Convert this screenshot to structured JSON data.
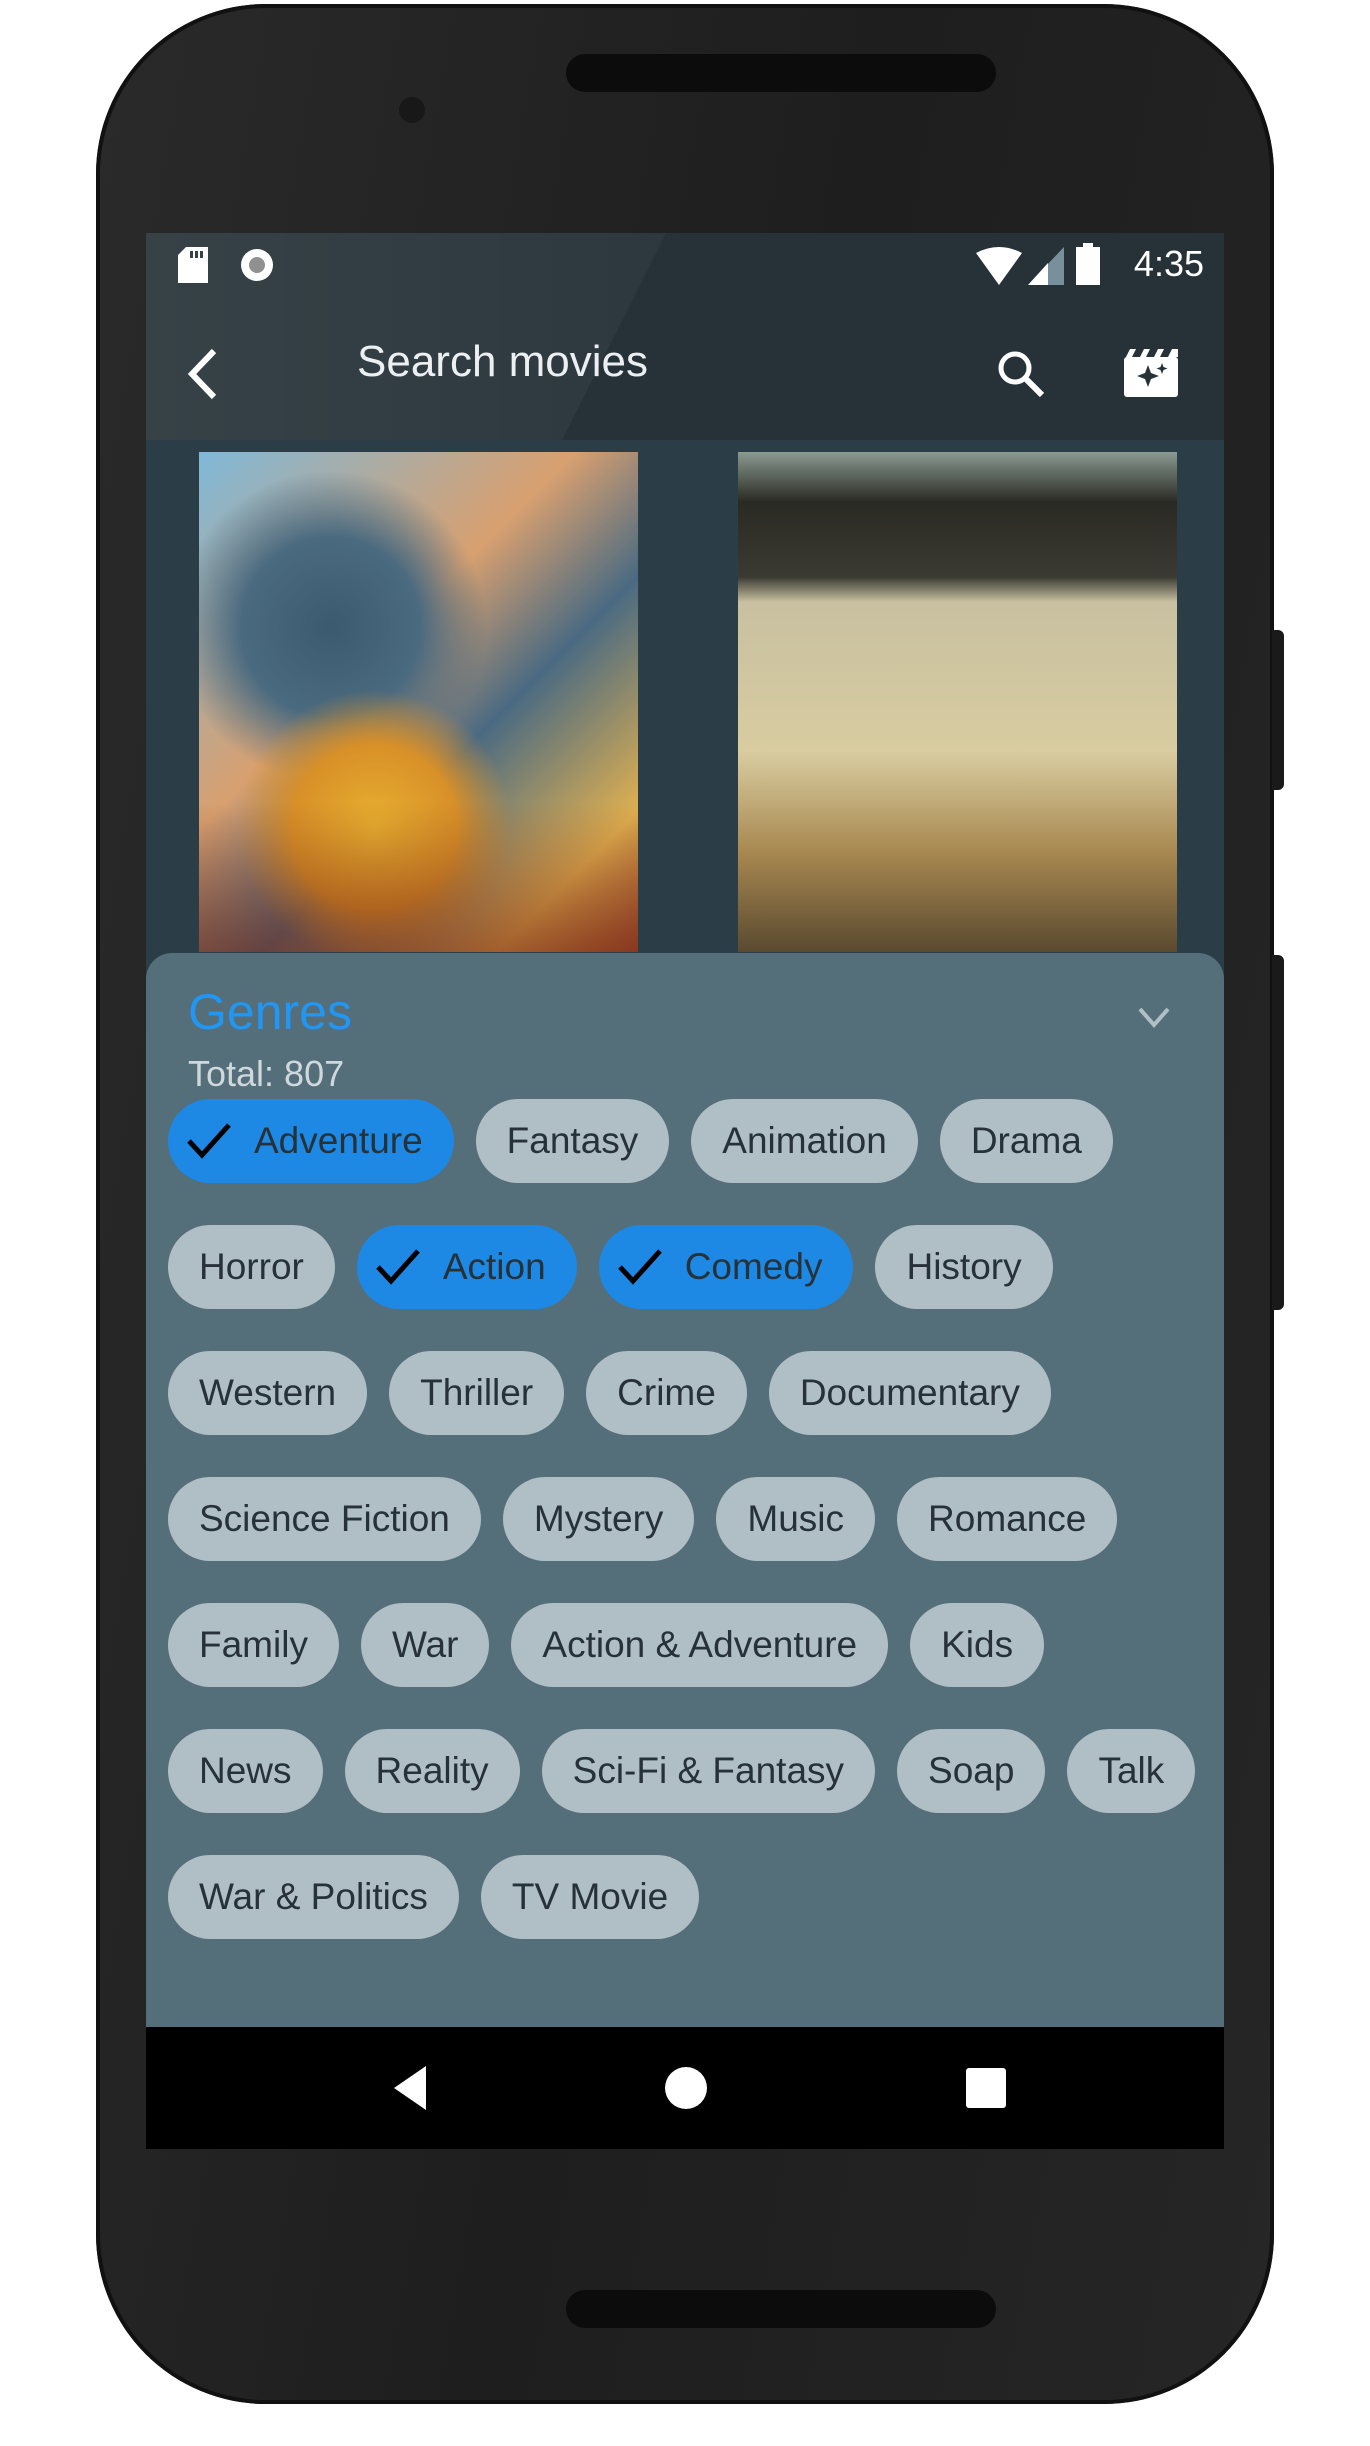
{
  "status_bar": {
    "time": "4:35",
    "left_icons": [
      "sd-card-icon",
      "sync-icon"
    ],
    "right_icons": [
      "wifi-icon",
      "signal-icon",
      "battery-icon"
    ]
  },
  "toolbar": {
    "title": "Search movies",
    "back_icon": "arrow-back-icon",
    "search_icon": "search-icon",
    "action_icon": "movie-filter-icon"
  },
  "genres": {
    "title": "Genres",
    "total": "Total: 807",
    "chips": [
      {
        "label": "Adventure",
        "selected": true
      },
      {
        "label": "Fantasy",
        "selected": false
      },
      {
        "label": "Animation",
        "selected": false
      },
      {
        "label": "Drama",
        "selected": false
      },
      {
        "label": "Horror",
        "selected": false
      },
      {
        "label": "Action",
        "selected": true
      },
      {
        "label": "Comedy",
        "selected": true
      },
      {
        "label": "History",
        "selected": false
      },
      {
        "label": "Western",
        "selected": false
      },
      {
        "label": "Thriller",
        "selected": false
      },
      {
        "label": "Crime",
        "selected": false
      },
      {
        "label": "Documentary",
        "selected": false
      },
      {
        "label": "Science Fiction",
        "selected": false
      },
      {
        "label": "Mystery",
        "selected": false
      },
      {
        "label": "Music",
        "selected": false
      },
      {
        "label": "Romance",
        "selected": false
      },
      {
        "label": "Family",
        "selected": false
      },
      {
        "label": "War",
        "selected": false
      },
      {
        "label": "Action & Adventure",
        "selected": false
      },
      {
        "label": "Kids",
        "selected": false
      },
      {
        "label": "News",
        "selected": false
      },
      {
        "label": "Reality",
        "selected": false
      },
      {
        "label": "Sci-Fi & Fantasy",
        "selected": false
      },
      {
        "label": "Soap",
        "selected": false
      },
      {
        "label": "Talk",
        "selected": false
      },
      {
        "label": "War & Politics",
        "selected": false
      },
      {
        "label": "TV Movie",
        "selected": false
      }
    ]
  },
  "colors": {
    "accent": "#1e88e5",
    "chip": "#b0bec5",
    "sheet": "#546e7a",
    "toolbar": "#263238",
    "title": "#2196f3"
  }
}
